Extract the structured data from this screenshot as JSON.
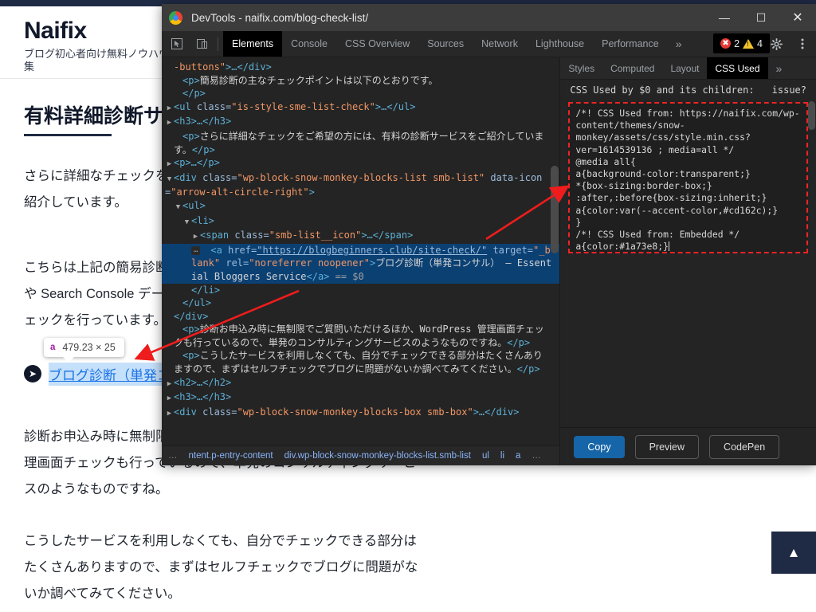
{
  "webpage": {
    "site_title": "Naifix",
    "site_tagline": "ブログ初心者向け無料ノウハウ集",
    "article_title": "有料詳細診断サービス",
    "paragraphs": [
      "さらに詳細なチェックをご希望の方には、有料の診断サービスをご紹介しています。",
      "こちらは上記の簡易診断に加えて、アクセス解析や Search Console データを使った詳細なチェックを行っています。",
      "診断お申込み時に無制限でご質問いただけるほか、WordPress 管理画面チェックも行っているので、単発のコンサルティングサービスのようなものですね。",
      "こうしたサービスを利用しなくても、自分でチェックできる部分はたくさんありますので、まずはセルフチェックでブログに問題がないか調べてみてください。"
    ],
    "p1_lines": [
      "さらに詳細なチェックをご希望の方には、有料の診断サー",
      "ビスをご",
      "紹介しています。"
    ],
    "p2_lines": [
      "こちらは上記の簡易診断に加えて、アクセス解析",
      "や Search Console データを使った詳細なチ",
      "ェックを行っています。"
    ],
    "p3_lines": [
      "診断お申込み時に無制限でご質問いただけるほか、",
      "理画面チェックも行っているので、単発のコンサルティングサービ",
      "スのようなものですね。"
    ],
    "p4_lines": [
      "こうしたサービスを利用しなくても、自分でチェックできる部分は",
      "たくさんありますので、まずはセルフチェックでブログに問題がな",
      "いか調べてみてください。"
    ],
    "inspected_link_text": "ブログ診断（単発コンサル）",
    "inspect_tooltip": {
      "tag": "a",
      "size": "479.23 × 25"
    },
    "link_bullet_icon": "arrow-right-circle-icon",
    "scroll_top_icon": "chevron-up-icon",
    "colors": {
      "navy": "#1f2a44",
      "link": "#1a73e8",
      "highlight": "#a8d0f7"
    }
  },
  "devtools": {
    "window_title": "DevTools - naifix.com/blog-check-list/",
    "window_controls": {
      "minimize": "—",
      "maximize": "☐",
      "close": "✕"
    },
    "toolbar": {
      "inspect_icon": "inspect-cursor-icon",
      "device_icon": "device-toolbar-icon",
      "tabs": [
        "Elements",
        "Console",
        "CSS Overview",
        "Sources",
        "Network",
        "Lighthouse",
        "Performance"
      ],
      "active_tab": "Elements",
      "more_tabs_icon": "chevron-double-right-icon",
      "error_count": "2",
      "warning_count": "4",
      "settings_icon": "gear-icon",
      "menu_icon": "kebab-menu-icon"
    },
    "dom": {
      "lines": [
        {
          "indent": 0,
          "twisty": "",
          "type": "raw",
          "text": "-buttons\">…</div>",
          "parts": [
            {
              "c": "val",
              "t": "-buttons\""
            },
            {
              "c": "tag",
              "t": ">…</div>"
            }
          ]
        },
        {
          "indent": 1,
          "twisty": "",
          "type": "text",
          "parts": [
            {
              "c": "tag",
              "t": "<p>"
            },
            {
              "c": "txt",
              "t": "簡易診断の主なチェックポイントは以下のとおりです。"
            }
          ]
        },
        {
          "indent": 1,
          "twisty": "",
          "type": "text",
          "parts": [
            {
              "c": "tag",
              "t": "</p>"
            }
          ]
        },
        {
          "indent": 0,
          "twisty": "▶",
          "type": "elem",
          "parts": [
            {
              "c": "tag",
              "t": "<ul "
            },
            {
              "c": "attr",
              "t": "class="
            },
            {
              "c": "val",
              "t": "\"is-style-sme-list-check\""
            },
            {
              "c": "tag",
              "t": ">…</ul>"
            }
          ]
        },
        {
          "indent": 0,
          "twisty": "▶",
          "type": "elem",
          "parts": [
            {
              "c": "tag",
              "t": "<h3>…</h3>"
            }
          ]
        },
        {
          "indent": 1,
          "twisty": "",
          "type": "text",
          "parts": [
            {
              "c": "tag",
              "t": "<p>"
            },
            {
              "c": "txt",
              "t": "さらに詳細なチェックをご希望の方には、有料の診断サービスをご紹介しています。"
            },
            {
              "c": "tag",
              "t": "</p>"
            }
          ]
        },
        {
          "indent": 0,
          "twisty": "▶",
          "type": "elem",
          "parts": [
            {
              "c": "tag",
              "t": "<p>…</p>"
            }
          ]
        },
        {
          "indent": 0,
          "twisty": "▼",
          "type": "elem",
          "parts": [
            {
              "c": "tag",
              "t": "<div "
            },
            {
              "c": "attr",
              "t": "class="
            },
            {
              "c": "val",
              "t": "\"wp-block-snow-monkey-blocks-list smb-list\""
            },
            {
              "c": "attr",
              "t": " data-icon="
            },
            {
              "c": "val",
              "t": "\"arrow-alt-circle-right\""
            },
            {
              "c": "tag",
              "t": ">"
            }
          ]
        },
        {
          "indent": 1,
          "twisty": "▼",
          "type": "elem",
          "parts": [
            {
              "c": "tag",
              "t": "<ul>"
            }
          ]
        },
        {
          "indent": 2,
          "twisty": "▼",
          "type": "elem",
          "parts": [
            {
              "c": "tag",
              "t": "<li>"
            }
          ]
        },
        {
          "indent": 3,
          "twisty": "▶",
          "type": "elem",
          "parts": [
            {
              "c": "tag",
              "t": "<span "
            },
            {
              "c": "attr",
              "t": "class="
            },
            {
              "c": "val",
              "t": "\"smb-list__icon\""
            },
            {
              "c": "tag",
              "t": ">…</span>"
            }
          ]
        }
      ],
      "selected_line": {
        "badge": "…",
        "parts": [
          {
            "c": "tag",
            "t": "<a "
          },
          {
            "c": "attr",
            "t": "href="
          },
          {
            "c": "lnk",
            "t": "\"https://blogbeginners.club/site-check/\""
          },
          {
            "c": "attr",
            "t": " target="
          },
          {
            "c": "val",
            "t": "\"_blank\""
          },
          {
            "c": "attr",
            "t": " rel="
          },
          {
            "c": "val",
            "t": "\"noreferrer noopener\""
          },
          {
            "c": "tag",
            "t": ">"
          },
          {
            "c": "txt",
            "t": "ブログ診断（単発コンサル） – Essential Bloggers Service"
          },
          {
            "c": "tag",
            "t": "</a>"
          },
          {
            "c": "dollar",
            "t": " == $0"
          }
        ]
      },
      "lines_after": [
        {
          "indent": 2,
          "twisty": "",
          "parts": [
            {
              "c": "tag",
              "t": "</li>"
            }
          ]
        },
        {
          "indent": 1,
          "twisty": "",
          "parts": [
            {
              "c": "tag",
              "t": "</ul>"
            }
          ]
        },
        {
          "indent": 0,
          "twisty": "",
          "parts": [
            {
              "c": "tag",
              "t": "</div>"
            }
          ]
        },
        {
          "indent": 1,
          "twisty": "",
          "parts": [
            {
              "c": "tag",
              "t": "<p>"
            },
            {
              "c": "txt",
              "t": "診断お申込み時に無制限でご質問いただけるほか、WordPress 管理画面チェックも行っているので、単発のコンサルティングサービスのようなものですね。"
            },
            {
              "c": "tag",
              "t": "</p>"
            }
          ]
        },
        {
          "indent": 1,
          "twisty": "",
          "parts": [
            {
              "c": "tag",
              "t": "<p>"
            },
            {
              "c": "txt",
              "t": "こうしたサービスを利用しなくても、自分でチェックできる部分はたくさんありますので、まずはセルフチェックでブログに問題がないか調べてみてください。"
            },
            {
              "c": "tag",
              "t": "</p>"
            }
          ]
        },
        {
          "indent": 0,
          "twisty": "▶",
          "parts": [
            {
              "c": "tag",
              "t": "<h2>…</h2>"
            }
          ]
        },
        {
          "indent": 0,
          "twisty": "▶",
          "parts": [
            {
              "c": "tag",
              "t": "<h3>…</h3>"
            }
          ]
        },
        {
          "indent": 0,
          "twisty": "▶",
          "parts": [
            {
              "c": "tag",
              "t": "<div "
            },
            {
              "c": "attr",
              "t": "class="
            },
            {
              "c": "val",
              "t": "\"wp-block-snow-monkey-blocks-box smb-box\""
            },
            {
              "c": "tag",
              "t": ">…</div>"
            }
          ]
        }
      ],
      "breadcrumb": [
        "…",
        "ntent.p-entry-content",
        "div.wp-block-snow-monkey-blocks-list.smb-list",
        "ul",
        "li",
        "a",
        "…"
      ]
    },
    "sidebar": {
      "tabs": [
        "Styles",
        "Computed",
        "Layout",
        "CSS Used"
      ],
      "active_tab": "CSS Used",
      "more_icon": "chevron-double-right-icon",
      "header_left": "CSS Used by $0 and its children:",
      "header_right": "issue?",
      "css_text": "/*! CSS Used from: https://naifix.com/wp-content/themes/snow-monkey/assets/css/style.min.css?ver=1614539136 ; media=all */\n@media all{\na{background-color:transparent;}\n*{box-sizing:border-box;}\n:after,:before{box-sizing:inherit;}\na{color:var(--accent-color,#cd162c);}\n}\n/*! CSS Used from: Embedded */\na{color:#1a73e8;}",
      "buttons": [
        "Copy",
        "Preview",
        "CodePen"
      ]
    }
  },
  "annotations": {
    "arrow_color": "#ee1c1c",
    "arrow_count": 2
  }
}
